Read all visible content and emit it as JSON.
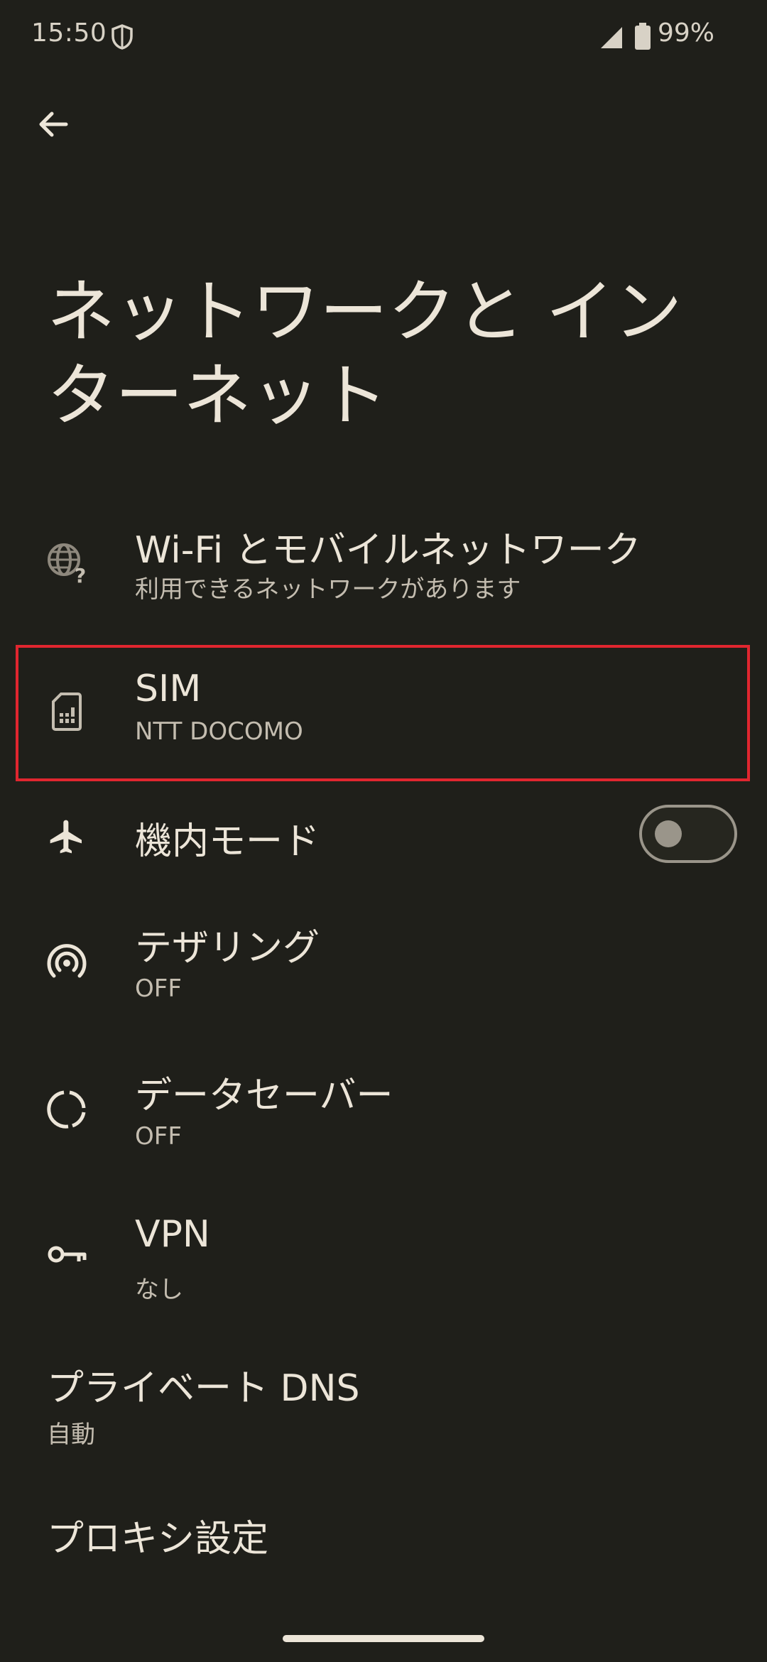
{
  "status_bar": {
    "time": "15:50",
    "battery": "99%"
  },
  "page": {
    "title": "ネットワークと インターネット"
  },
  "items": [
    {
      "title": "Wi-Fi とモバイルネットワーク",
      "subtitle": "利用できるネットワークがあります",
      "icon": "globe-question-icon"
    },
    {
      "title": "SIM",
      "subtitle": "NTT DOCOMO",
      "icon": "sim-card-icon"
    },
    {
      "title": "機内モード",
      "subtitle": "",
      "icon": "airplane-icon",
      "toggle": false
    },
    {
      "title": "テザリング",
      "subtitle": "OFF",
      "icon": "hotspot-icon"
    },
    {
      "title": "データセーバー",
      "subtitle": "OFF",
      "icon": "data-saver-icon"
    },
    {
      "title": "VPN",
      "subtitle": "なし",
      "icon": "key-icon"
    },
    {
      "title": "プライベート DNS",
      "subtitle": "自動",
      "icon": ""
    },
    {
      "title": "プロキシ設定",
      "subtitle": "",
      "icon": ""
    }
  ],
  "colors": {
    "background": "#1f1f1a",
    "text": "#ece5d8",
    "highlight": "#e0262f"
  }
}
